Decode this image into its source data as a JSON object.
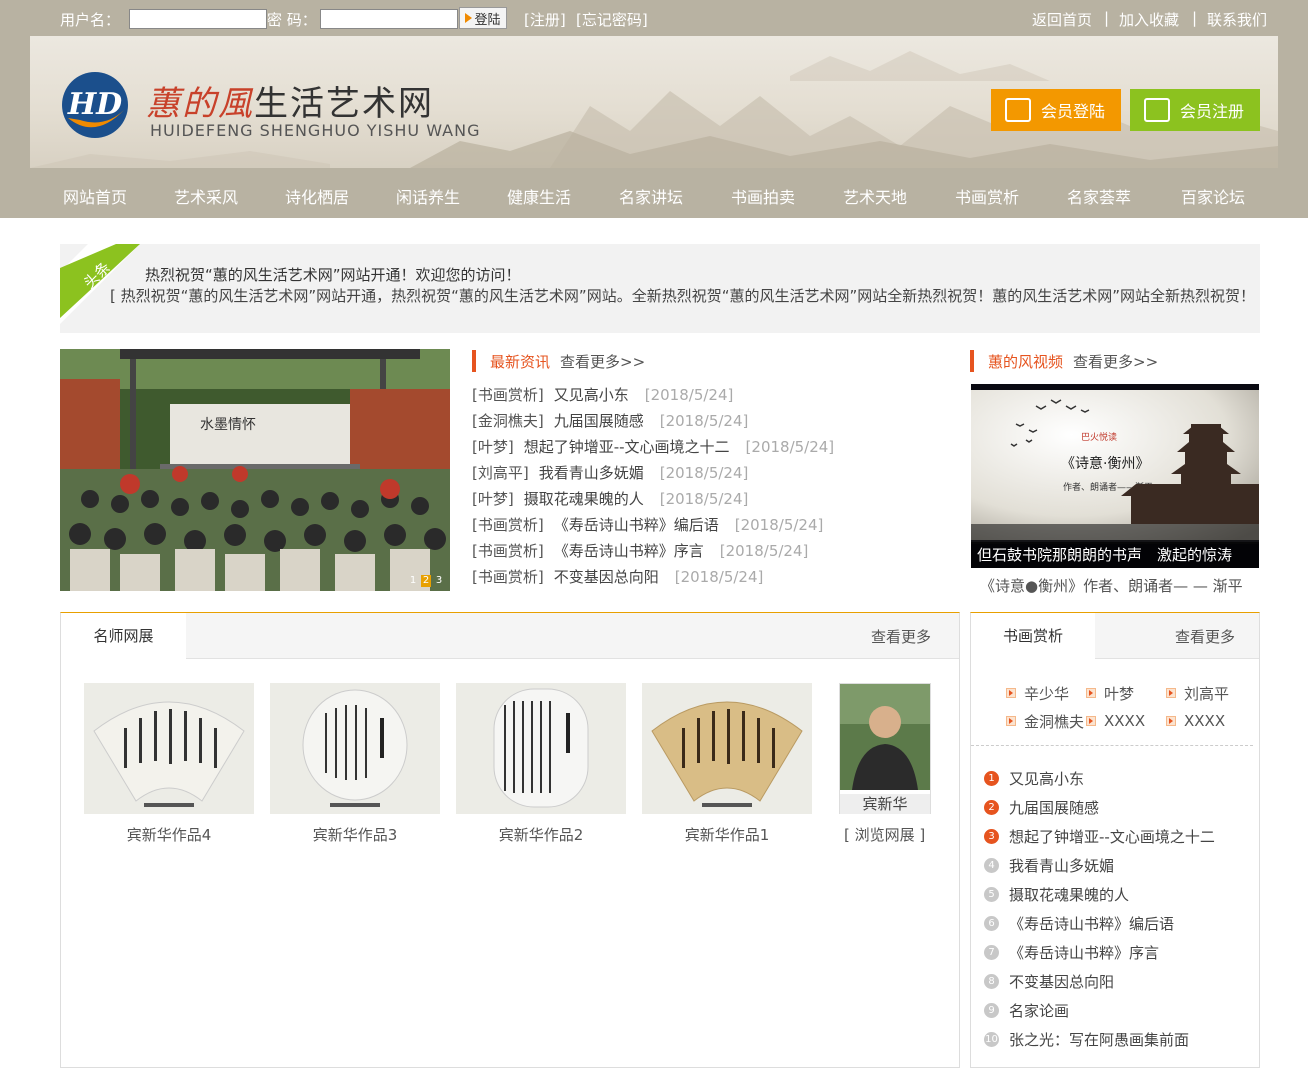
{
  "topbar": {
    "username_label": "用户名：",
    "password_label": "密  码：",
    "login_btn": "登陆",
    "register_link": "[注册]",
    "forgot_link": "[忘记密码]",
    "home_link": "返回首页",
    "fav_link": "加入收藏",
    "contact_link": "联系我们",
    "sep": "|"
  },
  "banner": {
    "logo_mark": "HD",
    "site_name_stylized": "蕙的風",
    "site_name_rest": "生活艺术网",
    "site_name_en": "HUIDEFENG SHENGHUO YISHU WANG",
    "member_login": "会员登陆",
    "member_register": "会员注册"
  },
  "nav": [
    "网站首页",
    "艺术采风",
    "诗化栖居",
    "闲话养生",
    "健康生活",
    "名家讲坛",
    "书画拍卖",
    "艺术天地",
    "书画赏析",
    "名家荟萃",
    "百家论坛"
  ],
  "headline": {
    "ribbon": "头条",
    "title": "热烈祝贺“蕙的风生活艺术网”网站开通！欢迎您的访问！",
    "body": "[ 热烈祝贺“蕙的风生活艺术网”网站开通，热烈祝贺“蕙的风生活艺术网”网站。全新热烈祝贺“蕙的风生活艺术网”网站全新热烈祝贺！蕙的风生活艺术网”网站全新热烈祝贺！ ]"
  },
  "slider": {
    "stage_banner": "水墨情怀",
    "dots": [
      "1",
      "2",
      "3"
    ]
  },
  "news": {
    "title": "最新资讯",
    "more": "查看更多>>",
    "items": [
      {
        "cat": "[书画赏析]",
        "title": "又见高小东",
        "date": "[2018/5/24]"
      },
      {
        "cat": "[金洞樵夫]",
        "title": "九届国展随感",
        "date": "[2018/5/24]"
      },
      {
        "cat": "[叶梦]",
        "title": "想起了钟增亚--文心画境之十二",
        "date": "[2018/5/24]"
      },
      {
        "cat": "[刘高平]",
        "title": "我看青山多妩媚",
        "date": "[2018/5/24]"
      },
      {
        "cat": "[叶梦]",
        "title": "摄取花魂果魄的人",
        "date": "[2018/5/24]"
      },
      {
        "cat": "[书画赏析]",
        "title": "《寿岳诗山书粹》编后语",
        "date": "[2018/5/24]"
      },
      {
        "cat": "[书画赏析]",
        "title": "《寿岳诗山书粹》序言",
        "date": "[2018/5/24]"
      },
      {
        "cat": "[书画赏析]",
        "title": "不变基因总向阳",
        "date": "[2018/5/24]"
      }
    ]
  },
  "video": {
    "title": "蕙的风视频",
    "more": "查看更多>>",
    "poster_tag": "巴火悦读",
    "poster_title": "《诗意·衡州》",
    "poster_sub": "作者、朗诵者——渐平",
    "caption": "但石鼓书院那朗朗的书声　激起的惊涛",
    "desc": "《诗意●衡州》作者、朗诵者— — 渐平"
  },
  "masters": {
    "tab": "名师网展",
    "more": "查看更多",
    "works": [
      {
        "caption": "宾新华作品4"
      },
      {
        "caption": "宾新华作品3"
      },
      {
        "caption": "宾新华作品2"
      },
      {
        "caption": "宾新华作品1"
      }
    ],
    "artist_name": "宾新华",
    "browse": "[ 浏览网展 ]"
  },
  "appreciation": {
    "tab": "书画赏析",
    "more": "查看更多",
    "authors": [
      "辛少华",
      "叶梦",
      "刘高平",
      "金洞樵夫",
      "XXXX",
      "XXXX"
    ],
    "ranking": [
      {
        "n": "1",
        "title": "又见高小东",
        "hot": true
      },
      {
        "n": "2",
        "title": "九届国展随感",
        "hot": true
      },
      {
        "n": "3",
        "title": "想起了钟增亚--文心画境之十二",
        "hot": true
      },
      {
        "n": "4",
        "title": "我看青山多妩媚",
        "hot": false
      },
      {
        "n": "5",
        "title": "摄取花魂果魄的人",
        "hot": false
      },
      {
        "n": "6",
        "title": "《寿岳诗山书粹》编后语",
        "hot": false
      },
      {
        "n": "7",
        "title": "《寿岳诗山书粹》序言",
        "hot": false
      },
      {
        "n": "8",
        "title": "不变基因总向阳",
        "hot": false
      },
      {
        "n": "9",
        "title": "名家论画",
        "hot": false
      },
      {
        "n": "10",
        "title": "张之光：写在阿愚画集前面",
        "hot": false
      }
    ]
  },
  "colors": {
    "header_bg": "#b8b2a2",
    "accent_orange": "#e6541f",
    "login_btn": "#f39800",
    "register_btn": "#8cc21f",
    "ribbon_green": "#8cc21f"
  }
}
